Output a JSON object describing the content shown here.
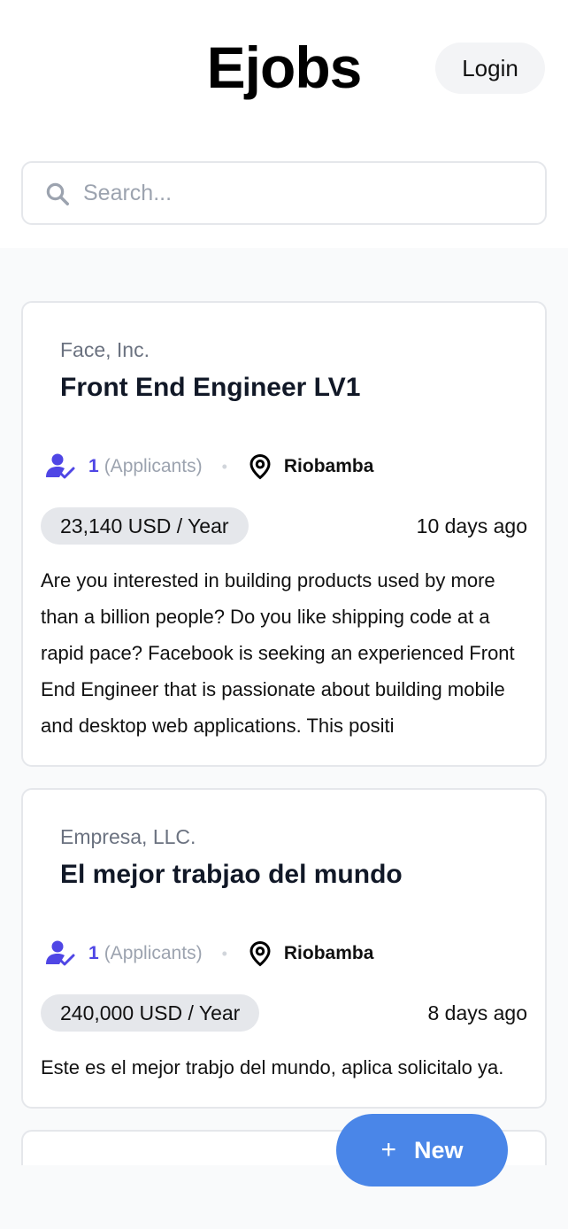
{
  "header": {
    "brand": "Ejobs",
    "login_label": "Login"
  },
  "search": {
    "placeholder": "Search..."
  },
  "jobs": [
    {
      "company": "Face, Inc.",
      "title": "Front End Engineer LV1",
      "applicants_count": "1",
      "applicants_label": "(Applicants)",
      "location": "Riobamba",
      "salary": "23,140 USD / Year",
      "posted": "10 days ago",
      "description": "Are you interested in building products used by more than a billion people? Do you like shipping code at a rapid pace? Facebook is seeking an experienced Front End Engineer that is passionate about building mobile and desktop web applications. This positi"
    },
    {
      "company": "Empresa, LLC.",
      "title": "El mejor trabjao del mundo",
      "applicants_count": "1",
      "applicants_label": "(Applicants)",
      "location": "Riobamba",
      "salary": "240,000 USD / Year",
      "posted": "8 days ago",
      "description": "Este es el mejor trabjo del mundo, aplica solicitalo ya."
    }
  ],
  "fab": {
    "plus": "+",
    "label": "New"
  },
  "colors": {
    "accent": "#4a86e8",
    "indigo": "#4f46e5",
    "muted": "#6b7280"
  },
  "icons": {
    "search": "search-icon",
    "applicants": "user-check-icon",
    "location": "map-pin-icon"
  }
}
